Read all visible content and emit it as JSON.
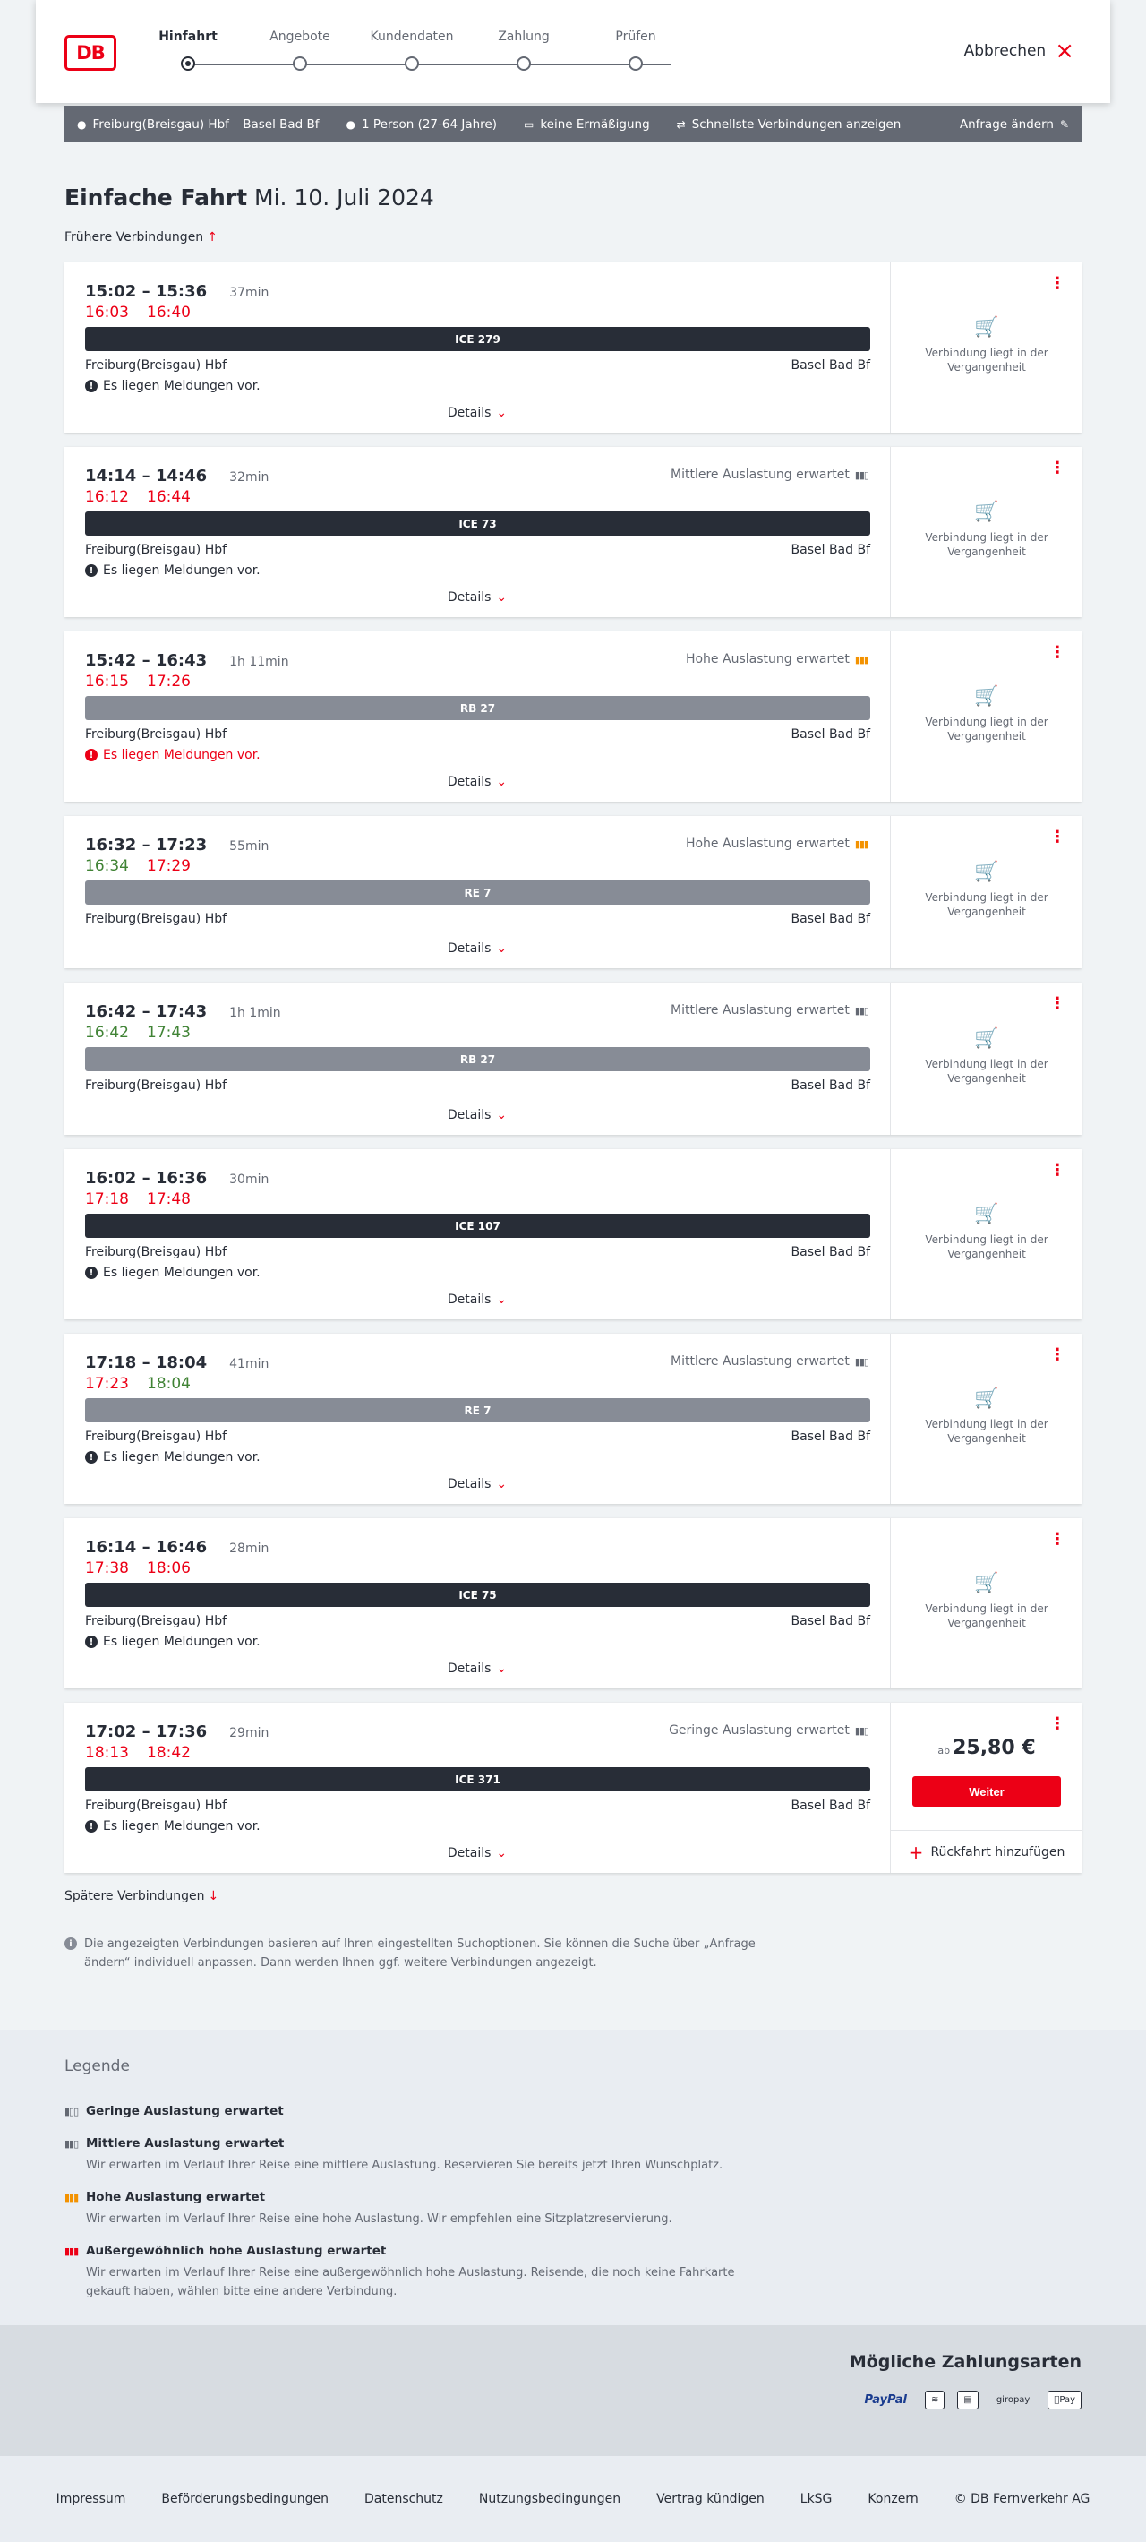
{
  "header": {
    "logo": "DB",
    "steps": [
      "Hinfahrt",
      "Angebote",
      "Kundendaten",
      "Zahlung",
      "Prüfen"
    ],
    "cancel_label": "Abbrechen"
  },
  "search_summary": {
    "route": "Freiburg(Breisgau) Hbf – Basel Bad Bf",
    "passengers": "1 Person (27-64 Jahre)",
    "discount": "keine Ermäßigung",
    "option": "Schnellste Verbindungen anzeigen",
    "change_label": "Anfrage ändern"
  },
  "page": {
    "title": "Einfache Fahrt",
    "date": "Mi. 10. Juli 2024",
    "earlier_label": "Frühere Verbindungen",
    "later_label": "Spätere Verbindungen",
    "details_label": "Details",
    "past_label": "Verbindung liegt in der Vergangenheit",
    "price_prefix": "ab",
    "continue_label": "Weiter",
    "return_label": "Rückfahrt hinzufügen",
    "info_text": "Die angezeigten Verbindungen basieren auf Ihren eingestellten Suchoptionen. Sie können die Suche über „Anfrage ändern“ individuell anpassen. Dann werden Ihnen ggf. weitere Verbindungen angezeigt."
  },
  "connections": [
    {
      "times": "15:02 – 15:36",
      "duration": "37min",
      "rt_dep": "16:03",
      "rt_arr": "16:40",
      "train": "ICE 279",
      "from": "Freiburg(Breisgau) Hbf",
      "to": "Basel Bad Bf",
      "notice": "Es liegen Meldungen vor.",
      "occupancy": ""
    },
    {
      "times": "14:14 – 14:46",
      "duration": "32min",
      "rt_dep": "16:12",
      "rt_arr": "16:44",
      "train": "ICE 73",
      "from": "Freiburg(Breisgau) Hbf",
      "to": "Basel Bad Bf",
      "notice": "Es liegen Meldungen vor.",
      "occupancy": "Mittlere Auslastung erwartet"
    },
    {
      "times": "15:42 – 16:43",
      "duration": "1h 11min",
      "rt_dep": "16:15",
      "rt_arr": "17:26",
      "train": "RB 27",
      "from": "Freiburg(Breisgau) Hbf",
      "to": "Basel Bad Bf",
      "notice": "Es liegen Meldungen vor.",
      "occupancy": "Hohe Auslastung erwartet"
    },
    {
      "times": "16:32 – 17:23",
      "duration": "55min",
      "rt_dep": "16:34",
      "rt_arr": "17:29",
      "train": "RE 7",
      "from": "Freiburg(Breisgau) Hbf",
      "to": "Basel Bad Bf",
      "notice": "",
      "occupancy": "Hohe Auslastung erwartet"
    },
    {
      "times": "16:42 – 17:43",
      "duration": "1h 1min",
      "rt_dep": "16:42",
      "rt_arr": "17:43",
      "train": "RB 27",
      "from": "Freiburg(Breisgau) Hbf",
      "to": "Basel Bad Bf",
      "notice": "",
      "occupancy": "Mittlere Auslastung erwartet"
    },
    {
      "times": "16:02 – 16:36",
      "duration": "30min",
      "rt_dep": "17:18",
      "rt_arr": "17:48",
      "train": "ICE 107",
      "from": "Freiburg(Breisgau) Hbf",
      "to": "Basel Bad Bf",
      "notice": "Es liegen Meldungen vor.",
      "occupancy": ""
    },
    {
      "times": "17:18 – 18:04",
      "duration": "41min",
      "rt_dep": "17:23",
      "rt_arr": "18:04",
      "train": "RE 7",
      "from": "Freiburg(Breisgau) Hbf",
      "to": "Basel Bad Bf",
      "notice": "Es liegen Meldungen vor.",
      "occupancy": "Mittlere Auslastung erwartet"
    },
    {
      "times": "16:14 – 16:46",
      "duration": "28min",
      "rt_dep": "17:38",
      "rt_arr": "18:06",
      "train": "ICE 75",
      "from": "Freiburg(Breisgau) Hbf",
      "to": "Basel Bad Bf",
      "notice": "Es liegen Meldungen vor.",
      "occupancy": ""
    },
    {
      "times": "17:02 – 17:36",
      "duration": "29min",
      "rt_dep": "18:13",
      "rt_arr": "18:42",
      "train": "ICE 371",
      "from": "Freiburg(Breisgau) Hbf",
      "to": "Basel Bad Bf",
      "notice": "Es liegen Meldungen vor.",
      "occupancy": "Geringe Auslastung erwartet",
      "price": "25,80 €"
    }
  ],
  "legend": {
    "title": "Legende",
    "items": [
      {
        "label": "Geringe Auslastung erwartet",
        "text": ""
      },
      {
        "label": "Mittlere Auslastung erwartet",
        "text": "Wir erwarten im Verlauf Ihrer Reise eine mittlere Auslastung. Reservieren Sie bereits jetzt Ihren Wunschplatz."
      },
      {
        "label": "Hohe Auslastung erwartet",
        "text": "Wir erwarten im Verlauf Ihrer Reise eine hohe Auslastung. Wir empfehlen eine Sitzplatzreservierung."
      },
      {
        "label": "Außergewöhnlich hohe Auslastung erwartet",
        "text": "Wir erwarten im Verlauf Ihrer Reise eine außergewöhnlich hohe Auslastung. Reisende, die noch keine Fahrkarte gekauft haben, wählen bitte eine andere Verbindung."
      }
    ]
  },
  "payment": {
    "title": "Mögliche Zahlungsarten",
    "methods": [
      "PayPal",
      "giropay",
      "Pay"
    ]
  },
  "footer": {
    "links": [
      "Impressum",
      "Beförderungsbedingungen",
      "Datenschutz",
      "Nutzungsbedingungen",
      "Vertrag kündigen",
      "LkSG",
      "Konzern",
      "© DB Fernverkehr AG"
    ]
  },
  "colors": {
    "accent": "#ec0016",
    "dark": "#282d37",
    "bar_gray": "#878c96",
    "delay_red": "#ec0016",
    "ontime_green": "#408335",
    "orange": "#f39200"
  }
}
